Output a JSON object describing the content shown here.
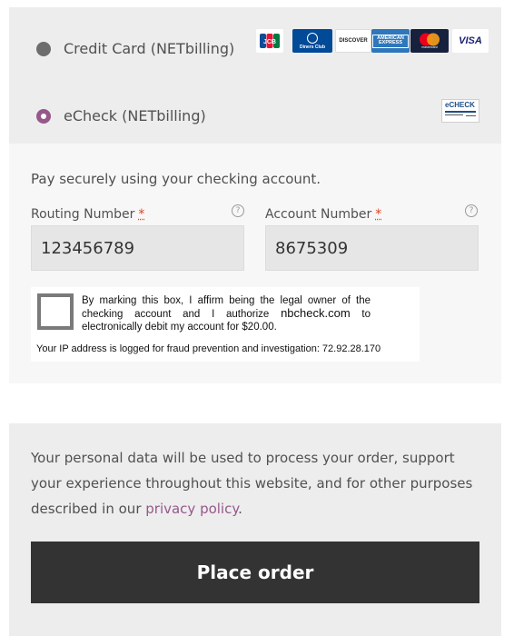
{
  "payment_methods": [
    {
      "label": "Credit Card (NETbilling)",
      "selected": false,
      "card_logos": [
        "JCB",
        "Diners Club",
        "DISCOVER",
        "AMERICAN EXPRESS",
        "mastercard",
        "VISA"
      ]
    },
    {
      "label": "eCheck (NETbilling)",
      "selected": true,
      "logo_text": "eCHECK"
    }
  ],
  "echeck": {
    "description": "Pay securely using your checking account.",
    "routing": {
      "label": "Routing Number",
      "required_mark": "*",
      "value": "123456789",
      "help_icon": "question-circle-icon"
    },
    "account": {
      "label": "Account Number",
      "required_mark": "*",
      "value": "8675309",
      "help_icon": "question-circle-icon"
    },
    "authorization": {
      "text_part1": "By marking this box, I affirm being the legal owner of the checking account and I authorize ",
      "domain": "nbcheck.com",
      "text_part2": " to electronically debit my account for $20.00.",
      "ip_notice": "Your IP address is logged for fraud prevention and investigation: 72.92.28.170"
    }
  },
  "privacy": {
    "text_before": "Your personal data will be used to process your order, support your experience throughout this website, and for other purposes described in our ",
    "link_text": "privacy policy",
    "text_after": "."
  },
  "place_order": {
    "label": "Place order"
  },
  "colors": {
    "accent": "#96588a",
    "button_bg": "#333333",
    "panel_bg": "#ededed",
    "required": "#e2401c"
  }
}
